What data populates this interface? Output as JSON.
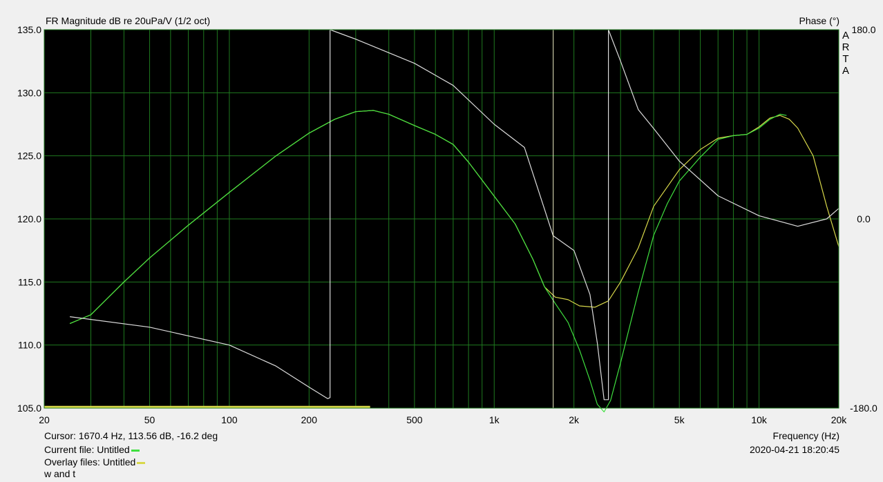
{
  "title": "FR Magnitude dB re 20uPa/V (1/2 oct)",
  "right_title": "Phase (°)",
  "brand": "A R T A",
  "cursor_text": "Cursor: 1670.4 Hz, 113.56 dB, -16.2 deg",
  "current_file": "Current file: Untitled",
  "overlay_files": "Overlay files: Untitled",
  "window_label": "w and t",
  "xlabel": "Frequency (Hz)",
  "timestamp": "2020-04-21  18:20:45",
  "colors": {
    "plot_bg": "#000000",
    "grid": "#1f7a1f",
    "current": "#3fe03f",
    "overlay": "#d8d84a",
    "phase": "#dddddd",
    "cursor": "#f2f2c8"
  },
  "chart_data": {
    "type": "line",
    "xscale": "log",
    "xlim": [
      20,
      20000
    ],
    "ylim": [
      105,
      135
    ],
    "y2lim": [
      -180,
      180
    ],
    "yticks": [
      {
        "v": 105,
        "label": "105.0"
      },
      {
        "v": 110,
        "label": "110.0"
      },
      {
        "v": 115,
        "label": "115.0"
      },
      {
        "v": 120,
        "label": "120.0"
      },
      {
        "v": 125,
        "label": "125.0"
      },
      {
        "v": 130,
        "label": "130.0"
      },
      {
        "v": 135,
        "label": "135.0"
      }
    ],
    "y2ticks": [
      {
        "v": -180,
        "label": "-180.0"
      },
      {
        "v": 0,
        "label": "0.0"
      },
      {
        "v": 180,
        "label": "180.0"
      }
    ],
    "xticks": [
      {
        "v": 20,
        "label": "20"
      },
      {
        "v": 50,
        "label": "50"
      },
      {
        "v": 100,
        "label": "100"
      },
      {
        "v": 200,
        "label": "200"
      },
      {
        "v": 500,
        "label": "500"
      },
      {
        "v": 1000,
        "label": "1k"
      },
      {
        "v": 2000,
        "label": "2k"
      },
      {
        "v": 5000,
        "label": "5k"
      },
      {
        "v": 10000,
        "label": "10k"
      },
      {
        "v": 20000,
        "label": "20k"
      }
    ],
    "cursor_x": 1670.4,
    "series": [
      {
        "name": "Overlay files: Untitled",
        "axis": "left",
        "color": "#d8d84a",
        "points": [
          [
            25,
            111.7
          ],
          [
            30,
            112.4
          ],
          [
            40,
            115.0
          ],
          [
            50,
            116.9
          ],
          [
            70,
            119.5
          ],
          [
            100,
            122.1
          ],
          [
            150,
            125.0
          ],
          [
            200,
            126.8
          ],
          [
            250,
            127.9
          ],
          [
            300,
            128.5
          ],
          [
            350,
            128.6
          ],
          [
            400,
            128.3
          ],
          [
            500,
            127.4
          ],
          [
            600,
            126.7
          ],
          [
            700,
            125.9
          ],
          [
            800,
            124.5
          ],
          [
            1000,
            121.8
          ],
          [
            1200,
            119.6
          ],
          [
            1400,
            116.8
          ],
          [
            1550,
            114.6
          ],
          [
            1700,
            113.8
          ],
          [
            1900,
            113.6
          ],
          [
            2100,
            113.1
          ],
          [
            2400,
            113.0
          ],
          [
            2700,
            113.5
          ],
          [
            3000,
            115.0
          ],
          [
            3500,
            117.7
          ],
          [
            4000,
            121.0
          ],
          [
            5000,
            123.9
          ],
          [
            6000,
            125.5
          ],
          [
            7000,
            126.4
          ],
          [
            8000,
            126.6
          ],
          [
            9000,
            126.7
          ],
          [
            10000,
            127.3
          ],
          [
            11000,
            128.0
          ],
          [
            12000,
            128.2
          ],
          [
            13000,
            127.9
          ],
          [
            14000,
            127.2
          ],
          [
            16000,
            125.0
          ],
          [
            18000,
            121.0
          ],
          [
            20000,
            117.8
          ]
        ]
      },
      {
        "name": "Current file: Untitled",
        "axis": "left",
        "color": "#3fe03f",
        "points": [
          [
            25,
            111.7
          ],
          [
            30,
            112.4
          ],
          [
            40,
            115.0
          ],
          [
            50,
            116.9
          ],
          [
            70,
            119.5
          ],
          [
            100,
            122.1
          ],
          [
            150,
            125.0
          ],
          [
            200,
            126.8
          ],
          [
            250,
            127.9
          ],
          [
            300,
            128.5
          ],
          [
            350,
            128.6
          ],
          [
            400,
            128.3
          ],
          [
            500,
            127.4
          ],
          [
            600,
            126.7
          ],
          [
            700,
            125.9
          ],
          [
            800,
            124.5
          ],
          [
            1000,
            121.8
          ],
          [
            1200,
            119.6
          ],
          [
            1400,
            116.8
          ],
          [
            1550,
            114.6
          ],
          [
            1700,
            113.3
          ],
          [
            1900,
            111.8
          ],
          [
            2100,
            109.6
          ],
          [
            2300,
            107.2
          ],
          [
            2450,
            105.3
          ],
          [
            2600,
            104.7
          ],
          [
            2750,
            105.6
          ],
          [
            3000,
            108.6
          ],
          [
            3500,
            114.2
          ],
          [
            4000,
            118.7
          ],
          [
            4500,
            121.2
          ],
          [
            5000,
            123.0
          ],
          [
            6000,
            124.9
          ],
          [
            7000,
            126.3
          ],
          [
            8000,
            126.6
          ],
          [
            9000,
            126.7
          ],
          [
            10000,
            127.2
          ],
          [
            11000,
            127.9
          ],
          [
            12000,
            128.3
          ],
          [
            12700,
            128.2
          ]
        ]
      },
      {
        "name": "Phase",
        "axis": "right",
        "color": "#dddddd",
        "points": [
          [
            25,
            -93
          ],
          [
            50,
            -103
          ],
          [
            100,
            -120
          ],
          [
            150,
            -140
          ],
          [
            200,
            -160
          ],
          [
            235,
            -171
          ],
          [
            240,
            -170
          ],
          [
            240,
            180
          ],
          [
            300,
            171
          ],
          [
            500,
            148
          ],
          [
            700,
            127
          ],
          [
            1000,
            90
          ],
          [
            1300,
            68
          ],
          [
            1670,
            -16
          ],
          [
            2000,
            -30
          ],
          [
            2300,
            -72
          ],
          [
            2450,
            -118
          ],
          [
            2600,
            -172
          ],
          [
            2700,
            -172
          ],
          [
            2700,
            180
          ],
          [
            3000,
            150
          ],
          [
            3500,
            104
          ],
          [
            4000,
            86
          ],
          [
            5000,
            55
          ],
          [
            7000,
            22
          ],
          [
            10000,
            3
          ],
          [
            14000,
            -7
          ],
          [
            18000,
            0
          ],
          [
            20000,
            10
          ]
        ]
      },
      {
        "name": "Overlay file line",
        "axis": "left",
        "color": "#d8d84a",
        "points": [
          [
            20,
            105.1
          ],
          [
            340,
            105.1
          ]
        ]
      }
    ]
  }
}
